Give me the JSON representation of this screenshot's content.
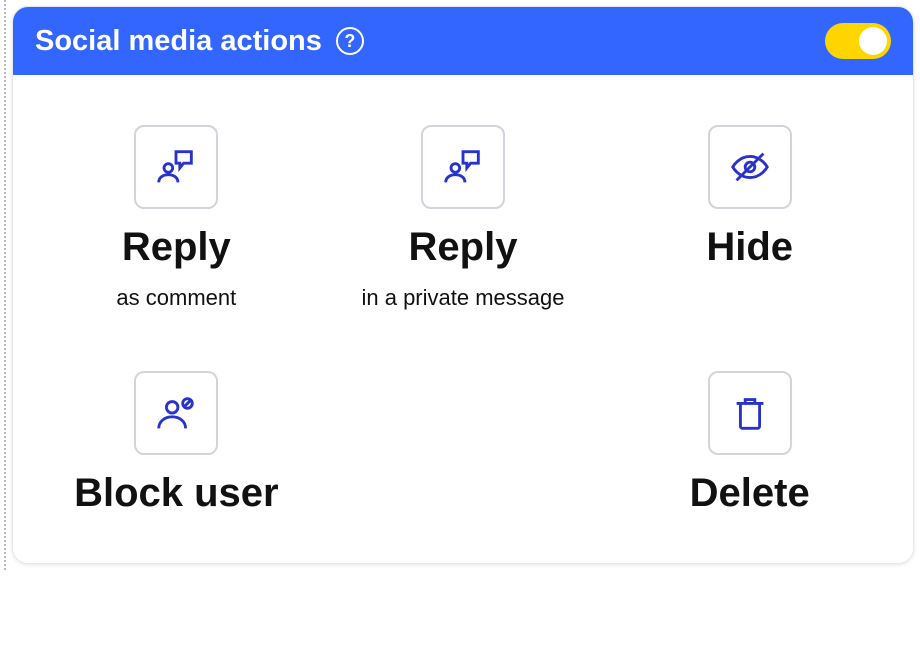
{
  "header": {
    "title": "Social media actions",
    "helpLabel": "?",
    "toggleOn": true
  },
  "actions": [
    {
      "title": "Reply",
      "subtitle": "as comment",
      "icon": "reply-person"
    },
    {
      "title": "Reply",
      "subtitle": "in a private message",
      "icon": "reply-person"
    },
    {
      "title": "Hide",
      "subtitle": "",
      "icon": "eye-off"
    },
    {
      "title": "Block user",
      "subtitle": "",
      "icon": "block-user"
    },
    {
      "title": "",
      "subtitle": "",
      "icon": ""
    },
    {
      "title": "Delete",
      "subtitle": "",
      "icon": "trash"
    }
  ]
}
